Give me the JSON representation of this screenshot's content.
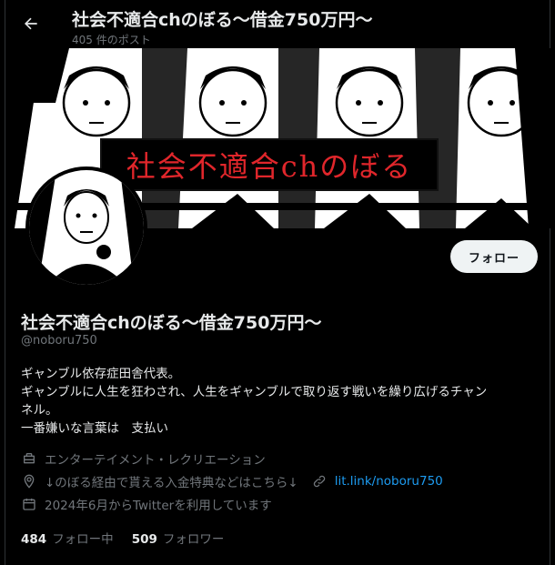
{
  "header": {
    "title": "社会不適合chのぼる〜借金750万円〜",
    "post_count": "405 件のポスト"
  },
  "banner": {
    "title_text": "社会不適合chのぼる"
  },
  "actions": {
    "follow_label": "フォロー"
  },
  "profile": {
    "display_name": "社会不適合chのぼる〜借金750万円〜",
    "handle": "@noboru750",
    "bio_lines": [
      "ギャンブル依存症田舎代表。",
      "ギャンブルに人生を狂わされ、人生をギャンブルで取り返す戦いを繰り広げるチャン",
      "ネル。",
      "一番嫌いな言葉は　支払い"
    ],
    "category": "エンターテイメント・レクリエーション",
    "location": "↓のぼる経由で貰える入金特典などはこちら↓",
    "link": "lit.link/noboru750",
    "joined": "2024年6月からTwitterを利用しています"
  },
  "stats": {
    "following_count": "484",
    "following_label": "フォロー中",
    "followers_count": "509",
    "followers_label": "フォロワー"
  },
  "icons": {
    "back": "arrow-left-icon",
    "category": "briefcase-icon",
    "location": "location-pin-icon",
    "link": "link-icon",
    "joined": "calendar-icon"
  },
  "colors": {
    "background": "#000000",
    "text": "#e7e9ea",
    "muted": "#71767b",
    "link": "#1d9bf0",
    "banner_title": "#e0262b",
    "button_bg": "#eff3f4"
  }
}
